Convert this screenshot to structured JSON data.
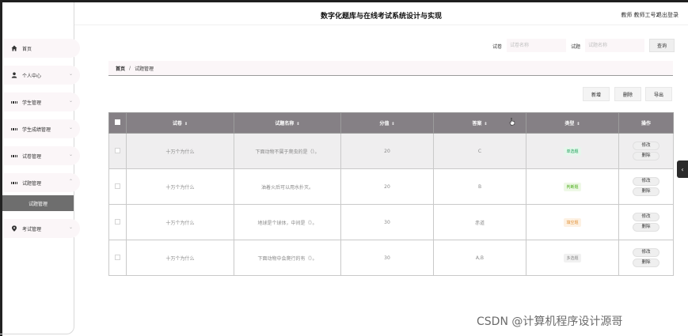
{
  "header": {
    "title": "数字化题库与在线考试系统设计与实现",
    "user": "教师 教师工号2",
    "logout": "退出登录"
  },
  "sidebar": {
    "items": [
      {
        "label": "首页",
        "icon": "home-icon",
        "chevron": false
      },
      {
        "label": "个人中心",
        "icon": "user-icon",
        "chevron": true
      },
      {
        "label": "学生管理",
        "icon": "grid-icon",
        "chevron": true
      },
      {
        "label": "学生成绩管理",
        "icon": "grid-icon",
        "chevron": true
      },
      {
        "label": "试卷管理",
        "icon": "grid-icon",
        "chevron": true
      },
      {
        "label": "试题管理",
        "icon": "grid-icon",
        "chevron": true,
        "expanded": true
      },
      {
        "label": "考试管理",
        "icon": "location-icon",
        "chevron": true
      }
    ],
    "sub_item": "试题管理"
  },
  "search": {
    "paper_label": "试卷",
    "paper_placeholder": "试卷名称",
    "question_label": "试题",
    "question_placeholder": "试题名称",
    "button": "查询"
  },
  "breadcrumb": {
    "home": "首页",
    "separator": "/",
    "current": "试题管理"
  },
  "actions": {
    "add": "新增",
    "delete": "删除",
    "export": "导出"
  },
  "table": {
    "columns": [
      "试卷",
      "试题名称",
      "分值",
      "答案",
      "类型",
      "操作"
    ],
    "sort_glyph": "⇕",
    "rows": [
      {
        "paper": "十万个为什么",
        "question": "下面动物不属于爬虫的是（）。",
        "score": "20",
        "answer": "C",
        "type": "单选题",
        "type_color": "#1ea35a",
        "type_bg": "#e6f6ec"
      },
      {
        "paper": "十万个为什么",
        "question": "油着火后可以用水扑灭。",
        "score": "20",
        "answer": "B",
        "type": "判断题",
        "type_color": "#4cae1c",
        "type_bg": "#eef8e6"
      },
      {
        "paper": "十万个为什么",
        "question": "地球是个球体，中间是（）。",
        "score": "30",
        "answer": "赤道",
        "type": "填空题",
        "type_color": "#e2933a",
        "type_bg": "#fdf1e3"
      },
      {
        "paper": "十万个为什么",
        "question": "下面动物中会爬行的有（）。",
        "score": "30",
        "answer": "A,B",
        "type": "多选题",
        "type_color": "#888888",
        "type_bg": "#f1f1f1"
      }
    ],
    "edit_label": "修改",
    "delete_label": "删除"
  },
  "toggle_glyph": "‹",
  "watermark": "CSDN @计算机程序设计源哥"
}
